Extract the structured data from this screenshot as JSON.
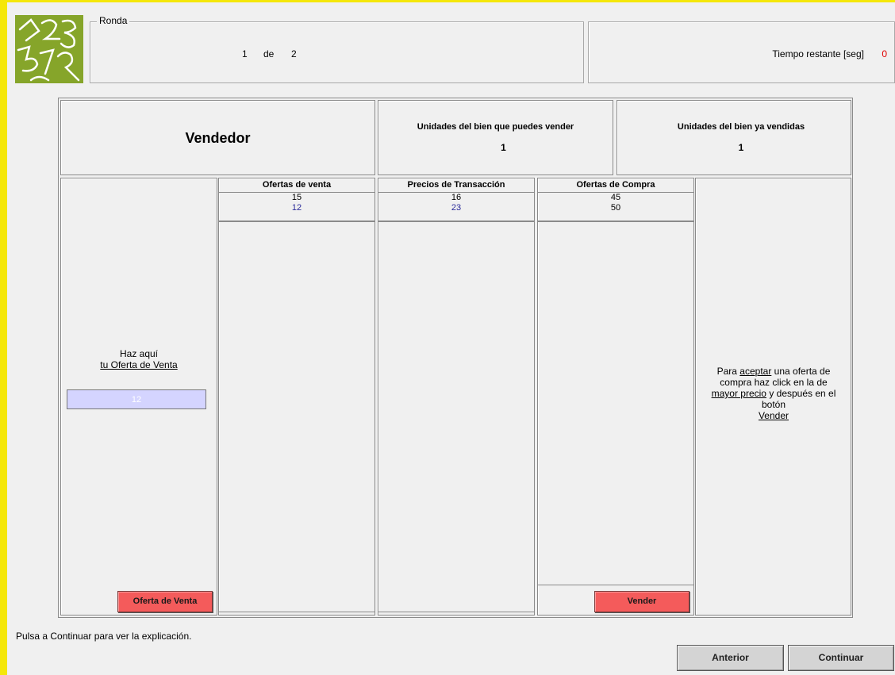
{
  "header": {
    "round_legend": "Ronda",
    "round_current": "1",
    "round_of": "de",
    "round_total": "2",
    "time_label": "Tiempo restante [seg]",
    "time_value": "0"
  },
  "role": {
    "title": "Vendedor",
    "units_can_sell_label": "Unidades del bien que puedes vender",
    "units_can_sell_value": "1",
    "units_sold_label": "Unidades del bien ya vendidas",
    "units_sold_value": "1"
  },
  "offer_entry": {
    "line1": "Haz aquí",
    "line2": "tu Oferta de Venta",
    "value": "12",
    "button": "Oferta de Venta"
  },
  "sell_offers": {
    "header": "Ofertas de venta",
    "rows": [
      "15",
      "12"
    ]
  },
  "transactions": {
    "header": "Precios de Transacción",
    "rows": [
      "16",
      "23"
    ]
  },
  "buy_offers": {
    "header": "Ofertas de Compra",
    "rows": [
      "45",
      "50"
    ],
    "button": "Vender"
  },
  "instructions": {
    "p1": "Para",
    "p2": "aceptar",
    "p3": "una oferta de compra haz click en la de",
    "p4": "mayor precio",
    "p5": "y después en el botón",
    "p6": "Vender"
  },
  "footer": {
    "message": "Pulsa a Continuar para ver la explicación.",
    "prev_button": "Anterior",
    "next_button": "Continuar"
  },
  "colors": {
    "accent_yellow": "#f5e70a",
    "button_red": "#f45b5b",
    "time_red": "#e00000",
    "logo_green": "#86a52a"
  }
}
